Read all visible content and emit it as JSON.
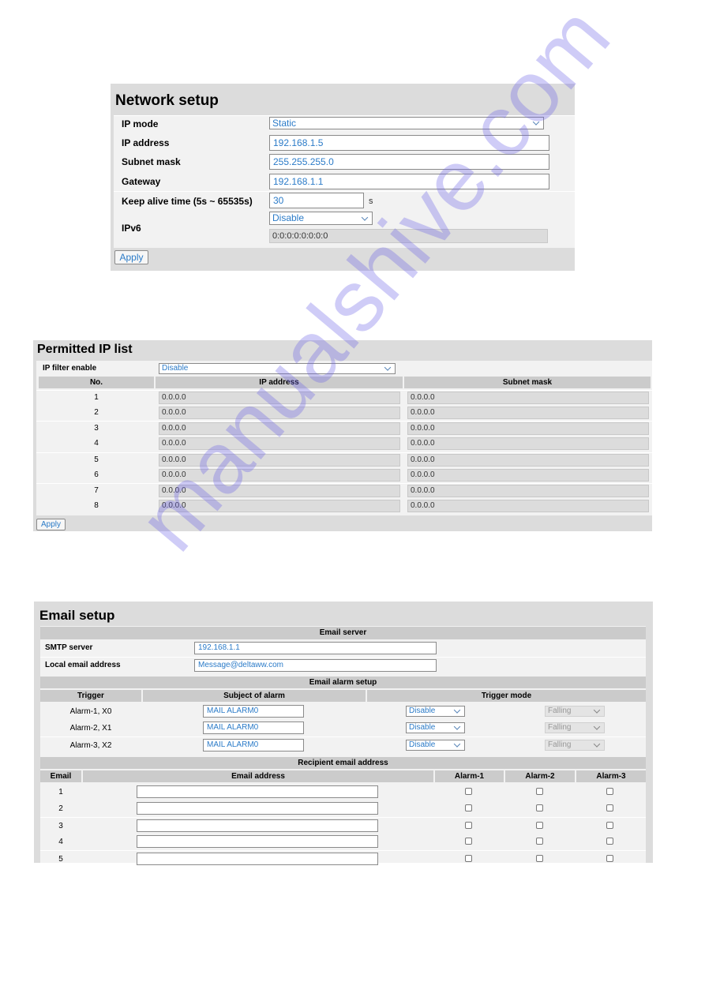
{
  "network": {
    "title": "Network setup",
    "ip_mode": {
      "label": "IP mode",
      "value": "Static"
    },
    "ip_address": {
      "label": "IP address",
      "value": "192.168.1.5"
    },
    "subnet_mask": {
      "label": "Subnet mask",
      "value": "255.255.255.0"
    },
    "gateway": {
      "label": "Gateway",
      "value": "192.168.1.1"
    },
    "keep_alive": {
      "label": "Keep alive time (5s ~ 65535s)",
      "value": "30",
      "unit": "s"
    },
    "ipv6": {
      "label": "IPv6",
      "mode": "Disable",
      "address": "0:0:0:0:0:0:0:0"
    },
    "apply_label": "Apply"
  },
  "permitted": {
    "title": "Permitted IP list",
    "filter_label": "IP filter enable",
    "filter_value": "Disable",
    "headers": [
      "No.",
      "IP address",
      "Subnet mask"
    ],
    "rows": [
      {
        "no": "1",
        "ip": "0.0.0.0",
        "mask": "0.0.0.0"
      },
      {
        "no": "2",
        "ip": "0.0.0.0",
        "mask": "0.0.0.0"
      },
      {
        "no": "3",
        "ip": "0.0.0.0",
        "mask": "0.0.0.0"
      },
      {
        "no": "4",
        "ip": "0.0.0.0",
        "mask": "0.0.0.0"
      },
      {
        "no": "5",
        "ip": "0.0.0.0",
        "mask": "0.0.0.0"
      },
      {
        "no": "6",
        "ip": "0.0.0.0",
        "mask": "0.0.0.0"
      },
      {
        "no": "7",
        "ip": "0.0.0.0",
        "mask": "0.0.0.0"
      },
      {
        "no": "8",
        "ip": "0.0.0.0",
        "mask": "0.0.0.0"
      }
    ],
    "apply_label": "Apply"
  },
  "email": {
    "title": "Email setup",
    "server_header": "Email server",
    "smtp": {
      "label": "SMTP server",
      "value": "192.168.1.1"
    },
    "local": {
      "label": "Local email address",
      "value": "Message@deltaww.com"
    },
    "alarm_header": "Email alarm setup",
    "alarm_columns": [
      "Trigger",
      "Subject of alarm",
      "Trigger mode"
    ],
    "alarms": [
      {
        "trigger": "Alarm-1, X0",
        "subject": "MAIL ALARM0",
        "mode": "Disable",
        "edge": "Falling"
      },
      {
        "trigger": "Alarm-2, X1",
        "subject": "MAIL ALARM0",
        "mode": "Disable",
        "edge": "Falling"
      },
      {
        "trigger": "Alarm-3, X2",
        "subject": "MAIL ALARM0",
        "mode": "Disable",
        "edge": "Falling"
      }
    ],
    "recipient_header": "Recipient email address",
    "recipient_columns": [
      "Email",
      "Email address",
      "Alarm-1",
      "Alarm-2",
      "Alarm-3"
    ],
    "recipients": [
      {
        "no": "1",
        "address": "",
        "alarm1": false,
        "alarm2": false,
        "alarm3": false
      },
      {
        "no": "2",
        "address": "",
        "alarm1": false,
        "alarm2": false,
        "alarm3": false
      },
      {
        "no": "3",
        "address": "",
        "alarm1": false,
        "alarm2": false,
        "alarm3": false
      },
      {
        "no": "4",
        "address": "",
        "alarm1": false,
        "alarm2": false,
        "alarm3": false
      },
      {
        "no": "5",
        "address": "",
        "alarm1": false,
        "alarm2": false,
        "alarm3": false
      }
    ]
  },
  "watermark": "manualshive.com"
}
